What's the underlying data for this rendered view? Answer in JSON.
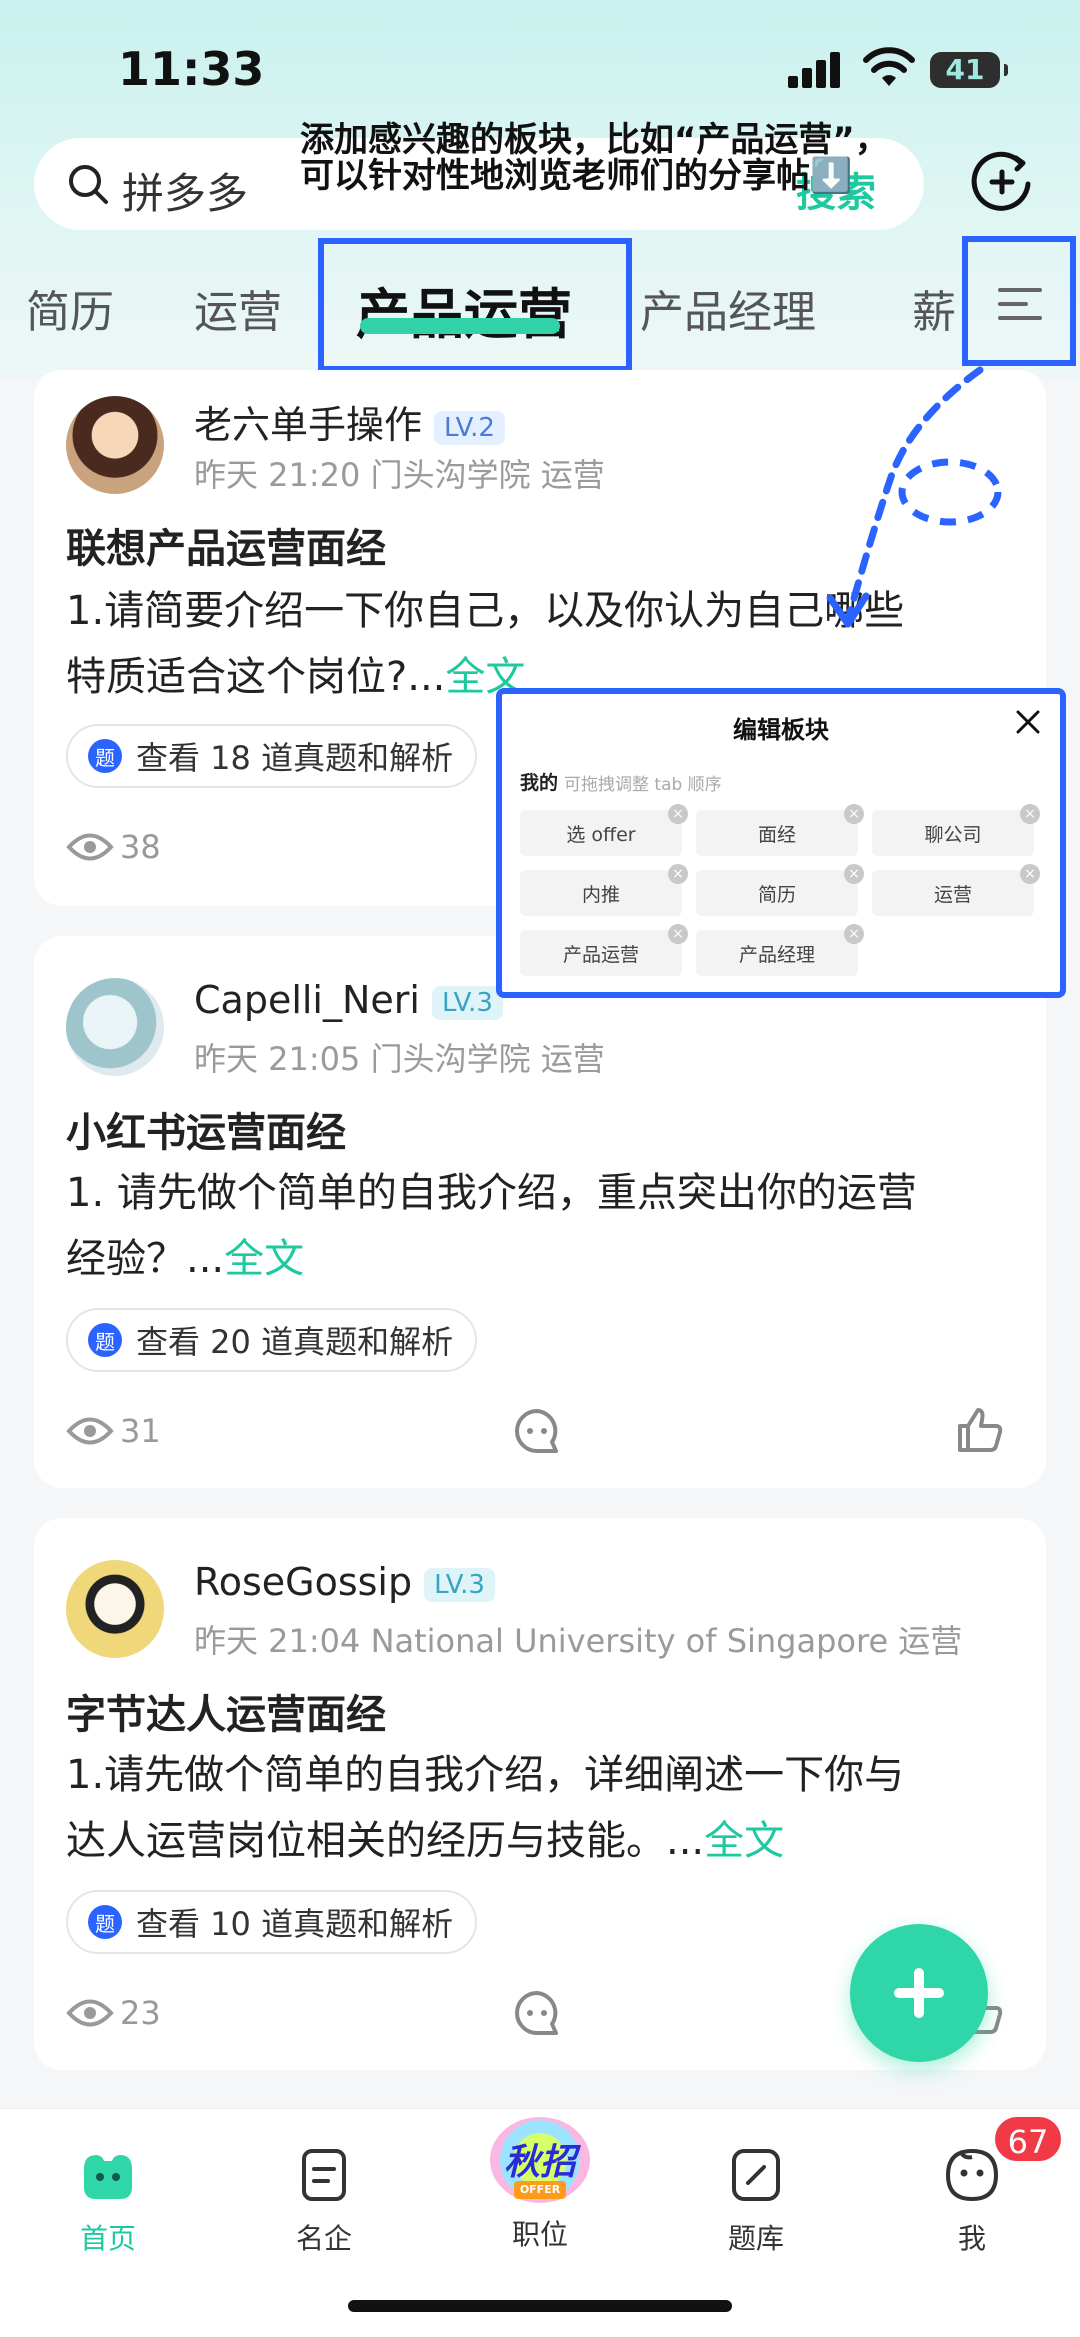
{
  "status": {
    "time": "11:33",
    "battery": "41"
  },
  "search": {
    "placeholder_text": "拼多多",
    "button": "搜索"
  },
  "hint": {
    "line1": "添加感兴趣的板块，比如“产品运营”，",
    "line2": "可以针对性地浏览老师们的分享帖⬇️"
  },
  "tabs": [
    "简历",
    "运营",
    "产品运营",
    "产品经理",
    "薪"
  ],
  "active_tab": "产品运营",
  "colors": {
    "accent": "#1ec9a0",
    "highlight": "#2a63ff",
    "badge": "#f23a46"
  },
  "posts": [
    {
      "user": "老六单手操作",
      "level": "LV.2",
      "meta": "昨天 21:20 门头沟学院 运营",
      "title": "联想产品运营面经",
      "body_line1": "1.请简要介绍一下你自己，以及你认为自己哪些",
      "body_line2": "特质适合这个岗位?...",
      "fulltext": "全文",
      "questions": "查看 18 道真题和解析",
      "views": "38"
    },
    {
      "user": "Capelli_Neri",
      "level": "LV.3",
      "meta": "昨天 21:05 门头沟学院 运营",
      "title": "小红书运营面经",
      "body_line1": "1. 请先做个简单的自我介绍，重点突出你的运营",
      "body_line2": "经验？...",
      "fulltext": "全文",
      "questions": "查看 20 道真题和解析",
      "views": "31"
    },
    {
      "user": "RoseGossip",
      "level": "LV.3",
      "meta": "昨天 21:04 National University of Singapore 运营",
      "title": "字节达人运营面经",
      "body_line1": "1.请先做个简单的自我介绍，详细阐述一下你与",
      "body_line2": "达人运营岗位相关的经历与技能。...",
      "fulltext": "全文",
      "questions": "查看 10 道真题和解析",
      "views": "23"
    }
  ],
  "popup": {
    "title": "编辑板块",
    "my_label": "我的",
    "hint": "可拖拽调整 tab 顺序",
    "tags": [
      "选 offer",
      "面经",
      "聊公司",
      "内推",
      "简历",
      "运营",
      "产品运营",
      "产品经理"
    ]
  },
  "nav": {
    "items": [
      "首页",
      "名企",
      "职位",
      "题库",
      "我"
    ],
    "active": "首页",
    "campus_badge": "秋招",
    "campus_sub": "OFFER",
    "me_badge": "67"
  }
}
